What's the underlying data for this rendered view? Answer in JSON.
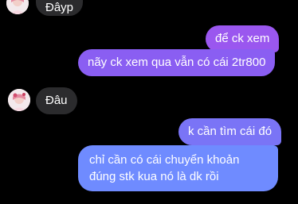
{
  "conversation": {
    "messages": [
      {
        "side": "incoming",
        "text": "Đâyp"
      },
      {
        "side": "outgoing",
        "text": "để ck xem"
      },
      {
        "side": "outgoing",
        "text": "nãy ck xem qua vẫn có cái 2tr800"
      },
      {
        "side": "incoming",
        "text": "Đâu"
      },
      {
        "side": "outgoing",
        "text": "k cần tìm cái đó"
      },
      {
        "side": "outgoing",
        "text": "chỉ cần có cái chuyển khoản đúng stk kua nó là dk rồi"
      }
    ]
  },
  "colors": {
    "background": "#000000",
    "incoming_bubble": "#2b2b2d",
    "outgoing_gradient_top": "#9a57ef",
    "outgoing_gradient_bottom": "#6f8bff"
  },
  "icons": {
    "contact_avatar": "avatar-icon"
  }
}
